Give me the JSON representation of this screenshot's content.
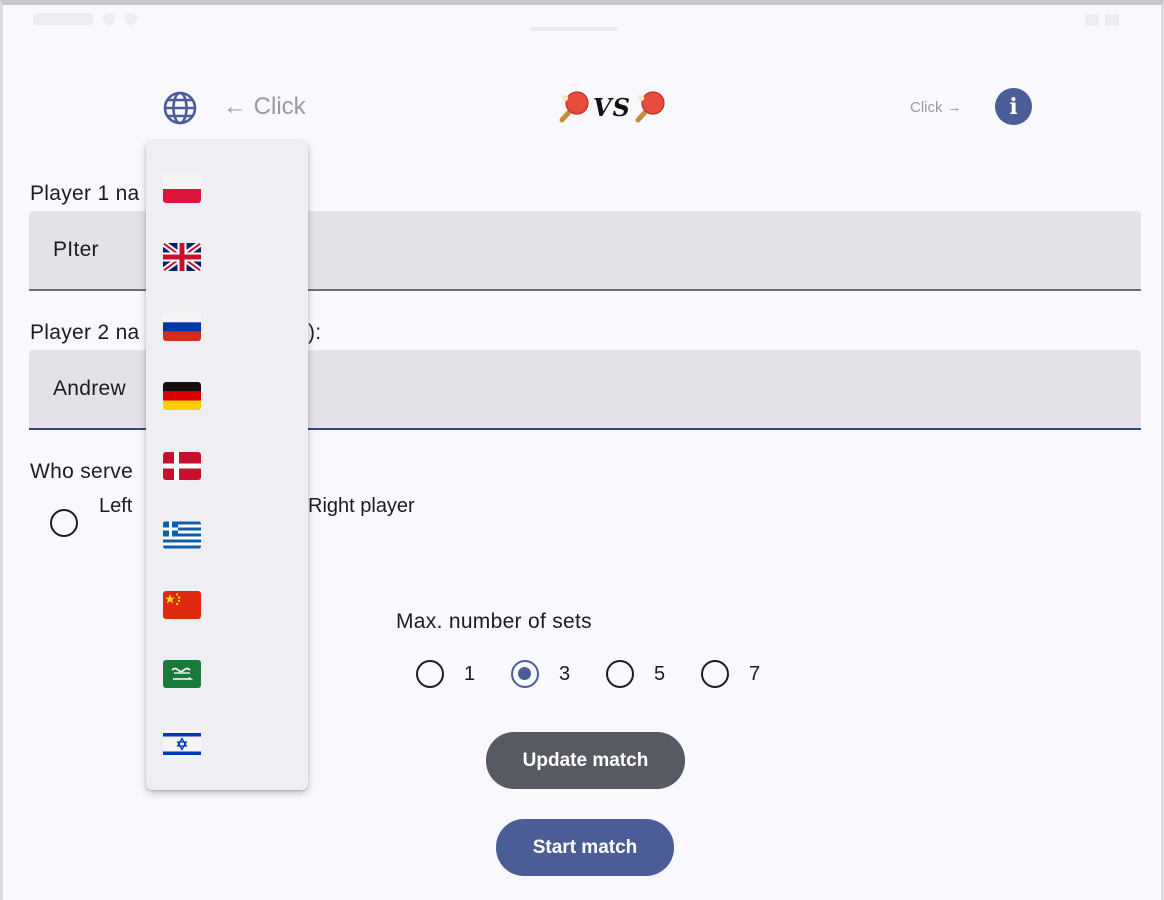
{
  "header": {
    "left_hint": "← Click",
    "title_text": "VS",
    "right_hint": "Click →",
    "info_icon_glyph": "i"
  },
  "language_menu": {
    "items": [
      {
        "flag": "poland-flag-icon"
      },
      {
        "flag": "united-kingdom-flag-icon"
      },
      {
        "flag": "russia-flag-icon"
      },
      {
        "flag": "germany-flag-icon"
      },
      {
        "flag": "denmark-flag-icon"
      },
      {
        "flag": "greece-flag-icon"
      },
      {
        "flag": "china-flag-icon"
      },
      {
        "flag": "saudi-arabia-flag-icon"
      },
      {
        "flag": "israel-flag-icon"
      }
    ]
  },
  "form": {
    "player1_label": "Player 1 na",
    "player1_value": "PIter",
    "player2_label": "Player 2 na",
    "player2_label_suffix": "):",
    "player2_value": "Andrew",
    "serve_label": "Who serve",
    "serve_options": {
      "left": "Left",
      "right": "Right player"
    },
    "sets_label": "Max. number of sets",
    "sets_options": [
      "1",
      "3",
      "5",
      "7"
    ],
    "sets_selected": "3"
  },
  "buttons": {
    "update": "Update match",
    "start": "Start match"
  },
  "colors": {
    "primary": "#4b5d97",
    "secondary_button": "#575a62",
    "field_bg": "#e4e2e8",
    "page_bg": "#f8f8fd"
  }
}
